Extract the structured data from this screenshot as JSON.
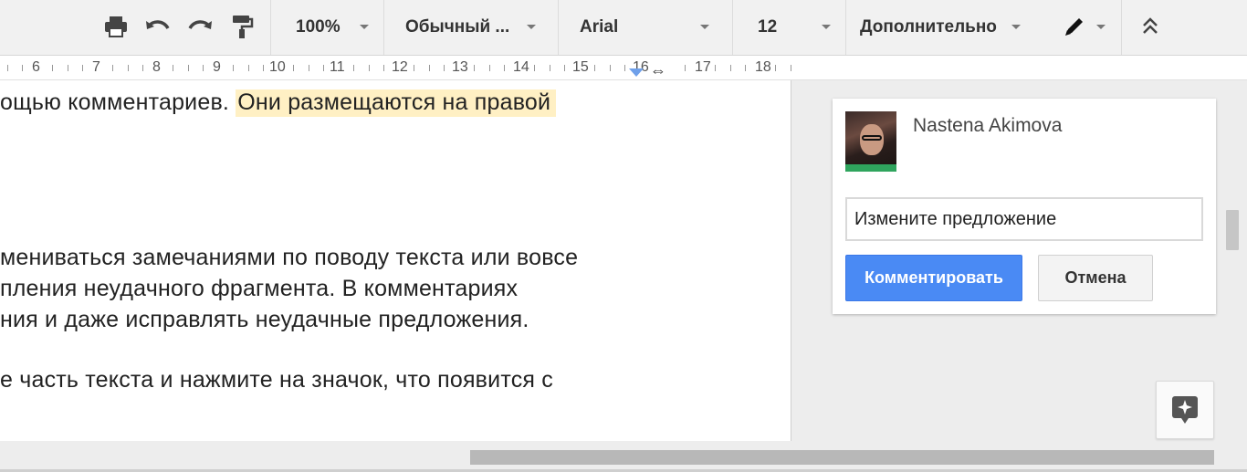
{
  "toolbar": {
    "icons": [
      "print-icon",
      "undo-icon",
      "redo-icon",
      "paint-format-icon"
    ],
    "zoom": "100%",
    "style": "Обычный ...",
    "font": "Arial",
    "font_size": "12",
    "more": "Дополнительно",
    "edit_mode_icon": "pencil-icon",
    "collapse_icon": "chevron-double-up-icon"
  },
  "ruler": {
    "numbers": [
      "6",
      "7",
      "8",
      "9",
      "10",
      "11",
      "12",
      "13",
      "14",
      "15",
      "16",
      "17",
      "18"
    ]
  },
  "document": {
    "line1_plain": "ощью комментариев. ",
    "line1_highlight": "Они размещаются на правой",
    "line2": "мениваться замечаниями по поводу текста или вовсе",
    "line3": "пления неудачного фрагмента. В комментариях",
    "line4": "ния и даже исправлять неудачные предложения.",
    "line5": "е часть текста и нажмите на значок, что появится с"
  },
  "comment": {
    "author": "Nastena Akimova",
    "input_value": "Измените предложение",
    "submit_label": "Комментировать",
    "cancel_label": "Отмена"
  },
  "colors": {
    "primary_button": "#4a8af4",
    "highlight": "#fff0c4",
    "avatar_status": "#2fa45d"
  }
}
